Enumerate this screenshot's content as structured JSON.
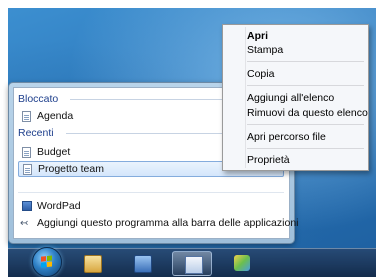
{
  "jump_list": {
    "pinned_header": "Bloccato",
    "pinned_items": [
      {
        "label": "Agenda"
      }
    ],
    "recent_header": "Recenti",
    "recent_items": [
      {
        "label": "Budget"
      },
      {
        "label": "Progetto team",
        "selected": true
      }
    ],
    "tasks": [
      {
        "label": "WordPad",
        "icon": "wordpad-icon"
      },
      {
        "label": "Aggiungi questo programma alla barra delle applicazioni",
        "icon": "pin-to-taskbar-icon"
      }
    ]
  },
  "context_menu": {
    "groups": [
      [
        {
          "label": "Apri",
          "default": true
        },
        {
          "label": "Stampa"
        }
      ],
      [
        {
          "label": "Copia"
        }
      ],
      [
        {
          "label": "Aggiungi all'elenco"
        },
        {
          "label": "Rimuovi da questo elenco"
        }
      ],
      [
        {
          "label": "Apri percorso file"
        }
      ],
      [
        {
          "label": "Proprietà"
        }
      ]
    ]
  },
  "taskbar": {
    "buttons": [
      {
        "icon": "windows-explorer-icon"
      },
      {
        "icon": "media-player-icon"
      },
      {
        "icon": "wordpad-icon",
        "active": true
      },
      {
        "icon": "paint-icon"
      }
    ]
  },
  "colors": {
    "group_header": "#1e3f8c",
    "selection_border": "#84acdd",
    "taskbar": "#1c3a63"
  }
}
